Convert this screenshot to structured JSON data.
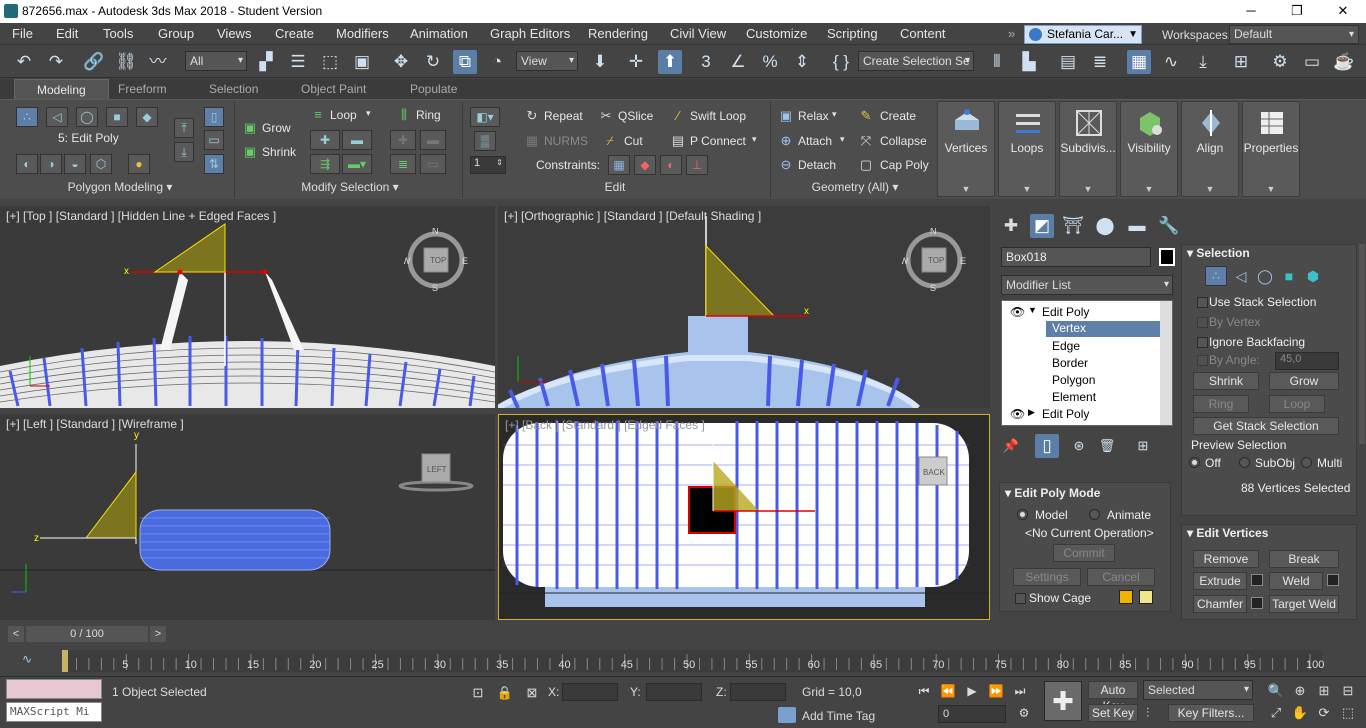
{
  "window": {
    "title": "872656.max - Autodesk 3ds Max 2018 - Student Version",
    "min": "─",
    "max": "❐",
    "close": "✕"
  },
  "menu": [
    "File",
    "Edit",
    "Tools",
    "Group",
    "Views",
    "Create",
    "Modifiers",
    "Animation",
    "Graph Editors",
    "Rendering",
    "Civil View",
    "Customize",
    "Scripting",
    "Content"
  ],
  "user": {
    "name": "Stefania Car...",
    "workspaces_label": "Workspaces:",
    "workspace": "Default"
  },
  "toolbar": {
    "filter": "All",
    "ref_coord": "View",
    "selection_set": "Create Selection Se"
  },
  "ribbon_tabs": [
    "Modeling",
    "Freeform",
    "Selection",
    "Object Paint",
    "Populate"
  ],
  "ribbon": {
    "polygon_modeling": {
      "label": "Polygon Modeling",
      "stack_item": "5: Edit Poly"
    },
    "modify_selection": {
      "label": "Modify Selection",
      "grow": "Grow",
      "shrink": "Shrink",
      "loop": "Loop",
      "ring": "Ring"
    },
    "edit": {
      "label": "Edit",
      "repeat": "Repeat",
      "qslice": "QSlice",
      "swift_loop": "Swift Loop",
      "nurms": "NURMS",
      "cut": "Cut",
      "p_connect": "P Connect",
      "constraints": "Constraints:",
      "spinner": "1"
    },
    "geometry": {
      "label": "Geometry (All)",
      "relax": "Relax",
      "create": "Create",
      "attach": "Attach",
      "collapse": "Collapse",
      "detach": "Detach",
      "cap_poly": "Cap Poly"
    },
    "big_buttons": [
      "Vertices",
      "Loops",
      "Subdivis...",
      "Visibility",
      "Align",
      "Properties"
    ]
  },
  "viewports": {
    "top": {
      "label": "[+] [Top ] [Standard ] [Hidden Line + Edged Faces ]",
      "cube": "TOP"
    },
    "persp": {
      "label": "[+] [Orthographic ] [Standard ] [Default Shading ]",
      "cube": "TOP"
    },
    "left": {
      "label": "[+] [Left ] [Standard ] [Wireframe ]",
      "cube": "LEFT"
    },
    "back": {
      "label": "[+] [Back ] [Standard ] [Edged Faces ]",
      "cube": "BACK"
    },
    "compass": {
      "n": "N",
      "s": "S",
      "e": "E",
      "w": "W"
    }
  },
  "cmdpanel": {
    "object_name": "Box018",
    "modifier_list": "Modifier List",
    "stack": [
      "Edit Poly",
      "Vertex",
      "Edge",
      "Border",
      "Polygon",
      "Element",
      "Edit Poly"
    ],
    "selection": {
      "title": "Selection",
      "use_stack": "Use Stack Selection",
      "by_vertex": "By Vertex",
      "ignore_backfacing": "Ignore Backfacing",
      "by_angle": "By Angle:",
      "angle": "45,0",
      "shrink": "Shrink",
      "grow": "Grow",
      "ring": "Ring",
      "loop": "Loop",
      "get_stack": "Get Stack Selection",
      "preview": "Preview Selection",
      "off": "Off",
      "subobj": "SubObj",
      "multi": "Multi",
      "count": "88 Vertices Selected"
    },
    "mode": {
      "title": "Edit Poly Mode",
      "model": "Model",
      "animate": "Animate",
      "no_op": "<No Current Operation>",
      "commit": "Commit",
      "settings": "Settings",
      "cancel": "Cancel",
      "show_cage": "Show Cage"
    },
    "edit_vertices": {
      "title": "Edit Vertices",
      "remove": "Remove",
      "break": "Break",
      "extrude": "Extrude",
      "weld": "Weld",
      "chamfer": "Chamfer",
      "target_weld": "Target Weld"
    }
  },
  "timeline": {
    "frame": "0 / 100",
    "ticks": [
      "5",
      "10",
      "15",
      "20",
      "25",
      "30",
      "35",
      "40",
      "45",
      "50",
      "55",
      "60",
      "65",
      "70",
      "75",
      "80",
      "85",
      "90",
      "95",
      "100"
    ]
  },
  "status": {
    "maxscript": "MAXScript Mi",
    "selected": "1 Object Selected",
    "x_label": "X:",
    "y_label": "Y:",
    "z_label": "Z:",
    "grid": "Grid = 10,0",
    "add_time_tag": "Add Time Tag",
    "auto_key": "Auto Key",
    "set_key": "Set Key",
    "key_mode": "Selected",
    "key_filters": "Key Filters...",
    "frame_value": "0"
  }
}
